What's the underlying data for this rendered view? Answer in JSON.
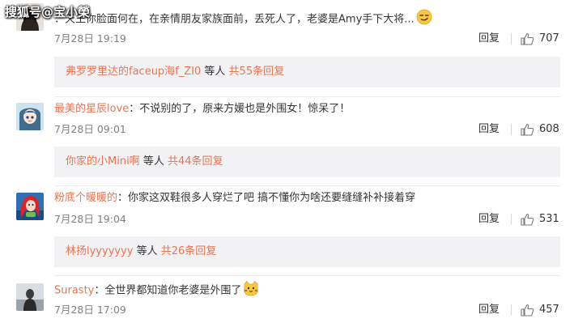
{
  "watermark": "搜狐号@宝小榮",
  "comments": [
    {
      "username": "",
      "colon": "：",
      "text": "天王你脸面何在，在亲情朋友家族面前，丢死人了，老婆是Amy手下大将...",
      "emoji": "smirk-emoji",
      "time": "7月28日 19:19",
      "reply_label": "回复",
      "likes": "707",
      "sub": {
        "user": "弗罗罗里达的faceup海f_ZI0",
        "mid": " 等人 ",
        "total": "共55条回复"
      }
    },
    {
      "username": "最美的星辰love",
      "colon": "：",
      "text": "不说别的了，原来方媛也是外围女！惊呆了！",
      "emoji": "",
      "time": "7月28日 09:01",
      "reply_label": "回复",
      "likes": "608",
      "sub": {
        "user": "你家的小Mini啊",
        "mid": " 等人 ",
        "total": "共44条回复"
      }
    },
    {
      "username": "粉底个暖暖的",
      "colon": "：",
      "text": "你家这双鞋很多人穿烂了吧 搞不懂你为啥还要缝缝补补接着穿",
      "emoji": "",
      "time": "7月28日 19:04",
      "reply_label": "回复",
      "likes": "531",
      "sub": {
        "user": "林扬lyyyyyyy",
        "mid": " 等人 ",
        "total": "共26条回复"
      }
    },
    {
      "username": "Surasty",
      "colon": "：",
      "text": "全世界都知道你老婆是外围了",
      "emoji": "cat-emoji",
      "time": "7月28日 17:09",
      "reply_label": "回复",
      "likes": "457"
    }
  ],
  "colors": {
    "username": "#eb7350",
    "reply_bg": "#f2f2f5",
    "time": "#808080"
  }
}
